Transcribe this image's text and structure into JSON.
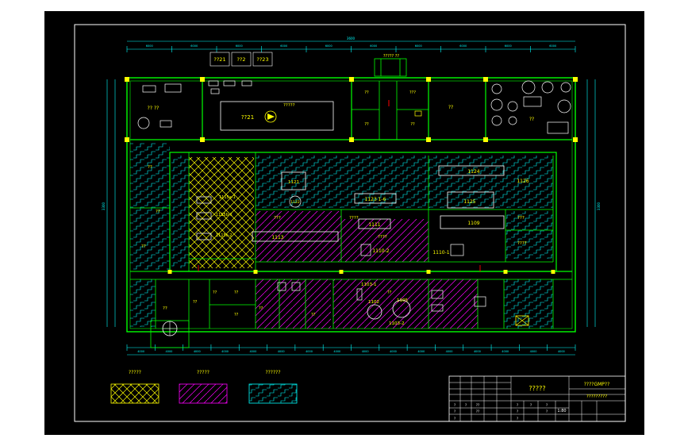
{
  "colors": {
    "page": "#ffffff",
    "sheet": "#000000",
    "frame": "#ffffff",
    "wall": "#00ff00",
    "line": "#00ffff",
    "dim": "#00ffff",
    "label": "#ffff00",
    "equip": "#ffffff",
    "column": "#ffff00",
    "hatch_hundred_k": "#ffff00",
    "hatch_ten_k": "#ff00ff",
    "hatch_general": "#00ffff",
    "door": "#ff0000"
  },
  "dims": {
    "top_total": "3600",
    "top_segments": [
      "6000",
      "6000",
      "6000",
      "6000",
      "6000",
      "6000",
      "6000",
      "6000",
      "6000",
      "6000"
    ],
    "left_total": "3300",
    "right_total": "3300",
    "bottom_segments": [
      "4000",
      "4000",
      "4000",
      "4000",
      "4000",
      "4000",
      "4000",
      "4000",
      "4000",
      "4000",
      "4000",
      "4000",
      "4000",
      "4000",
      "4000",
      "4000"
    ]
  },
  "rooms": {
    "tanks_top": [
      "??21",
      "??2",
      "??23"
    ],
    "top_center_title": "????? ??",
    "r_left_top": "?? ??",
    "r_center_label": "??21",
    "r_center_tag": "?????",
    "r_a1": "??",
    "r_a2": "???",
    "r_a3": "??",
    "r_a4": "??",
    "r_b": "??",
    "r_c": "??",
    "r_left_mid1": "??",
    "r_left_mid2": "??",
    "r_left_mid3": "??",
    "r_left_bottom": "??",
    "num_1121": "1121",
    "num_1122": "1122",
    "num_1123": "1123 1-6",
    "num_1124": "1124",
    "num_1126": "1126",
    "num_1125": "1125",
    "num_1109": "1109",
    "num_1115a": "1115a-1",
    "num_1115b": "1115b-1",
    "num_1115c": "1115c-2",
    "num_1113": "1113",
    "num_1111": "1111",
    "num_1110_2": "1110-2",
    "num_1110_1": "1110-1",
    "num_1103_1": "1103-1",
    "num_1103_2": "1103-2",
    "num_1105": "1105",
    "num_1102": "1102",
    "lbl_a": "???",
    "lbl_b": "????",
    "lbl_c": "????",
    "lbl_d": "???",
    "lbl_e": "????",
    "lbl_f": "??",
    "lbl_g": "??",
    "lbl_h": "??",
    "lbl_i": "??",
    "lbl_j": "??",
    "lbl_k": "??",
    "lbl_l": "??"
  },
  "legend": [
    {
      "label": "?????",
      "pattern": "crosshatch"
    },
    {
      "label": "?????",
      "pattern": "diagonal"
    },
    {
      "label": "??????",
      "pattern": "steps"
    }
  ],
  "title_block": {
    "title": "?????",
    "project": "????GMP??",
    "drawing": "?????????",
    "scale": "1:80",
    "cells_top": [
      "",
      "",
      "",
      "",
      "",
      "",
      ""
    ],
    "row_a": [
      "?",
      "?",
      "??",
      "?",
      "?",
      "?"
    ],
    "row_b": [
      "?",
      "??",
      "?",
      "?"
    ],
    "row_c": [
      "?",
      "?"
    ]
  }
}
